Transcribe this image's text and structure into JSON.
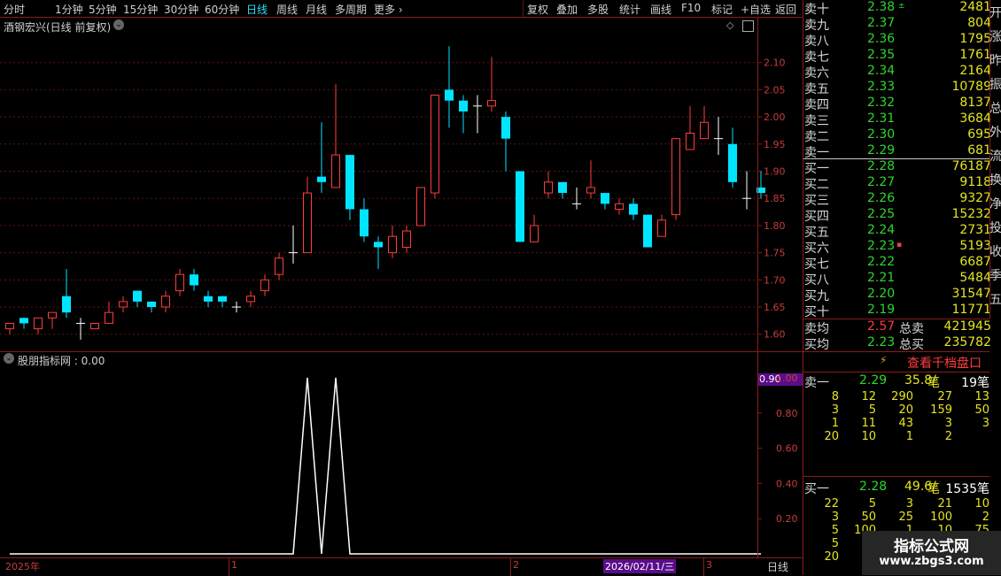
{
  "toolbar": {
    "periods": [
      "分时",
      "1分钟",
      "5分钟",
      "15分钟",
      "30分钟",
      "60分钟",
      "日线",
      "周线",
      "月线",
      "多周期",
      "更多"
    ],
    "active": "日线",
    "tools": [
      "复权",
      "叠加",
      "多股",
      "统计",
      "画线",
      "F10",
      "标记",
      "+自选",
      "返回"
    ]
  },
  "chart_title": "酒钢宏兴(日线 前复权)",
  "indicator_title": "股朋指标网 : 0.00",
  "indicator_value_tag": "0.90",
  "bottom_axis": {
    "labels": [
      "2025年",
      "1",
      "2",
      "2026/02/11/三",
      "3"
    ],
    "period": "日线"
  },
  "order_book": {
    "asks": [
      {
        "label": "卖十",
        "price": "2.38",
        "flag": "±",
        "volume": "2481"
      },
      {
        "label": "卖九",
        "price": "2.37",
        "flag": "",
        "volume": "804"
      },
      {
        "label": "卖八",
        "price": "2.36",
        "flag": "",
        "volume": "1795"
      },
      {
        "label": "卖七",
        "price": "2.35",
        "flag": "",
        "volume": "1761"
      },
      {
        "label": "卖六",
        "price": "2.34",
        "flag": "",
        "volume": "2164"
      },
      {
        "label": "卖五",
        "price": "2.33",
        "flag": "",
        "volume": "10789"
      },
      {
        "label": "卖四",
        "price": "2.32",
        "flag": "",
        "volume": "8137"
      },
      {
        "label": "卖三",
        "price": "2.31",
        "flag": "",
        "volume": "3684"
      },
      {
        "label": "卖二",
        "price": "2.30",
        "flag": "",
        "volume": "695"
      },
      {
        "label": "卖一",
        "price": "2.29",
        "flag": "",
        "volume": "681"
      }
    ],
    "bids": [
      {
        "label": "买一",
        "price": "2.28",
        "flag": "",
        "volume": "76187"
      },
      {
        "label": "买二",
        "price": "2.27",
        "flag": "",
        "volume": "9118"
      },
      {
        "label": "买三",
        "price": "2.26",
        "flag": "",
        "volume": "9327"
      },
      {
        "label": "买四",
        "price": "2.25",
        "flag": "",
        "volume": "15232"
      },
      {
        "label": "买五",
        "price": "2.24",
        "flag": "",
        "volume": "2731"
      },
      {
        "label": "买六",
        "price": "2.23",
        "flag": "▪",
        "volume": "5193"
      },
      {
        "label": "买七",
        "price": "2.22",
        "flag": "",
        "volume": "6687"
      },
      {
        "label": "买八",
        "price": "2.21",
        "flag": "",
        "volume": "5484"
      },
      {
        "label": "买九",
        "price": "2.20",
        "flag": "",
        "volume": "31547"
      },
      {
        "label": "买十",
        "price": "2.19",
        "flag": "",
        "volume": "11771"
      }
    ],
    "summary": [
      {
        "label": "卖均",
        "price": "2.57",
        "total_label": "总卖",
        "total": "421945"
      },
      {
        "label": "买均",
        "price": "2.23",
        "total_label": "总买",
        "total": "235782"
      }
    ],
    "thousand_link": "查看千档盘口",
    "sell1": {
      "label": "卖一",
      "price": "2.29",
      "avg": "35.8/",
      "unit": "笔",
      "count": "19",
      "count_unit": "笔"
    },
    "sell1_queue": [
      [
        "8",
        "12",
        "290",
        "27",
        "13"
      ],
      [
        "3",
        "5",
        "20",
        "159",
        "50"
      ],
      [
        "1",
        "11",
        "43",
        "3",
        "3"
      ],
      [
        "20",
        "10",
        "1",
        "2",
        ""
      ]
    ],
    "buy1": {
      "label": "买一",
      "price": "2.28",
      "avg": "49.6/",
      "unit": "笔",
      "count": "1535",
      "count_unit": "笔"
    },
    "buy1_queue": [
      [
        "22",
        "5",
        "3",
        "21",
        "10"
      ],
      [
        "3",
        "50",
        "25",
        "100",
        "2"
      ],
      [
        "5",
        "100",
        "1",
        "10",
        "75"
      ],
      [
        "5",
        "",
        "",
        "",
        ""
      ],
      [
        "20",
        "",
        "",
        "",
        ""
      ]
    ]
  },
  "edge_text": [
    "开",
    "涨",
    "昨",
    "振",
    "总",
    "外",
    "流",
    "换",
    "净",
    "投",
    "收",
    "季",
    "五"
  ],
  "watermark": {
    "title": "指标公式网",
    "url": "www.zbgs3.com"
  },
  "chart_data": [
    {
      "type": "candlestick",
      "title": "酒钢宏兴(日线 前复权)",
      "yticks": [
        1.6,
        1.65,
        1.7,
        1.75,
        1.8,
        1.85,
        1.9,
        1.95,
        2.0,
        2.05,
        2.1
      ],
      "ylim": [
        1.58,
        2.15
      ],
      "up_color": "#ff3c3c",
      "down_color": "#00e5ff",
      "doji_color": "#ffffff",
      "candles": [
        {
          "o": 1.61,
          "c": 1.62,
          "h": 1.62,
          "l": 1.6
        },
        {
          "o": 1.63,
          "c": 1.62,
          "h": 1.63,
          "l": 1.61
        },
        {
          "o": 1.61,
          "c": 1.63,
          "h": 1.63,
          "l": 1.6
        },
        {
          "o": 1.63,
          "c": 1.64,
          "h": 1.64,
          "l": 1.61
        },
        {
          "o": 1.67,
          "c": 1.64,
          "h": 1.72,
          "l": 1.63
        },
        {
          "o": 1.62,
          "c": 1.62,
          "h": 1.63,
          "l": 1.59
        },
        {
          "o": 1.61,
          "c": 1.62,
          "h": 1.62,
          "l": 1.61
        },
        {
          "o": 1.62,
          "c": 1.64,
          "h": 1.66,
          "l": 1.62
        },
        {
          "o": 1.65,
          "c": 1.66,
          "h": 1.67,
          "l": 1.64
        },
        {
          "o": 1.68,
          "c": 1.66,
          "h": 1.68,
          "l": 1.65
        },
        {
          "o": 1.66,
          "c": 1.65,
          "h": 1.66,
          "l": 1.64
        },
        {
          "o": 1.65,
          "c": 1.67,
          "h": 1.68,
          "l": 1.64
        },
        {
          "o": 1.68,
          "c": 1.71,
          "h": 1.72,
          "l": 1.67
        },
        {
          "o": 1.71,
          "c": 1.69,
          "h": 1.72,
          "l": 1.68
        },
        {
          "o": 1.67,
          "c": 1.66,
          "h": 1.68,
          "l": 1.65
        },
        {
          "o": 1.67,
          "c": 1.66,
          "h": 1.67,
          "l": 1.65
        },
        {
          "o": 1.65,
          "c": 1.65,
          "h": 1.66,
          "l": 1.64
        },
        {
          "o": 1.66,
          "c": 1.67,
          "h": 1.68,
          "l": 1.65
        },
        {
          "o": 1.68,
          "c": 1.7,
          "h": 1.71,
          "l": 1.67
        },
        {
          "o": 1.71,
          "c": 1.74,
          "h": 1.75,
          "l": 1.7
        },
        {
          "o": 1.75,
          "c": 1.75,
          "h": 1.8,
          "l": 1.73
        },
        {
          "o": 1.75,
          "c": 1.86,
          "h": 1.89,
          "l": 1.75
        },
        {
          "o": 1.89,
          "c": 1.88,
          "h": 1.99,
          "l": 1.86
        },
        {
          "o": 1.87,
          "c": 1.93,
          "h": 2.06,
          "l": 1.87
        },
        {
          "o": 1.93,
          "c": 1.83,
          "h": 1.93,
          "l": 1.81
        },
        {
          "o": 1.83,
          "c": 1.78,
          "h": 1.85,
          "l": 1.77
        },
        {
          "o": 1.77,
          "c": 1.76,
          "h": 1.78,
          "l": 1.72
        },
        {
          "o": 1.75,
          "c": 1.78,
          "h": 1.8,
          "l": 1.74
        },
        {
          "o": 1.76,
          "c": 1.79,
          "h": 1.8,
          "l": 1.75
        },
        {
          "o": 1.8,
          "c": 1.87,
          "h": 1.87,
          "l": 1.8
        },
        {
          "o": 1.86,
          "c": 2.04,
          "h": 2.04,
          "l": 1.85
        },
        {
          "o": 2.05,
          "c": 2.03,
          "h": 2.13,
          "l": 1.98
        },
        {
          "o": 2.03,
          "c": 2.01,
          "h": 2.04,
          "l": 1.97
        },
        {
          "o": 2.02,
          "c": 2.02,
          "h": 2.04,
          "l": 1.97
        },
        {
          "o": 2.02,
          "c": 2.03,
          "h": 2.11,
          "l": 2.01
        },
        {
          "o": 2.0,
          "c": 1.96,
          "h": 2.01,
          "l": 1.9
        },
        {
          "o": 1.9,
          "c": 1.77,
          "h": 1.9,
          "l": 1.77
        },
        {
          "o": 1.77,
          "c": 1.8,
          "h": 1.82,
          "l": 1.77
        },
        {
          "o": 1.86,
          "c": 1.88,
          "h": 1.9,
          "l": 1.85
        },
        {
          "o": 1.88,
          "c": 1.86,
          "h": 1.88,
          "l": 1.85
        },
        {
          "o": 1.84,
          "c": 1.84,
          "h": 1.87,
          "l": 1.83
        },
        {
          "o": 1.86,
          "c": 1.87,
          "h": 1.92,
          "l": 1.85
        },
        {
          "o": 1.86,
          "c": 1.84,
          "h": 1.86,
          "l": 1.83
        },
        {
          "o": 1.83,
          "c": 1.84,
          "h": 1.85,
          "l": 1.82
        },
        {
          "o": 1.84,
          "c": 1.82,
          "h": 1.85,
          "l": 1.81
        },
        {
          "o": 1.82,
          "c": 1.76,
          "h": 1.82,
          "l": 1.76
        },
        {
          "o": 1.78,
          "c": 1.81,
          "h": 1.82,
          "l": 1.78
        },
        {
          "o": 1.82,
          "c": 1.96,
          "h": 1.96,
          "l": 1.81
        },
        {
          "o": 1.94,
          "c": 1.97,
          "h": 2.02,
          "l": 1.94
        },
        {
          "o": 1.96,
          "c": 1.99,
          "h": 2.02,
          "l": 1.96
        },
        {
          "o": 1.96,
          "c": 1.96,
          "h": 2.0,
          "l": 1.93
        },
        {
          "o": 1.95,
          "c": 1.88,
          "h": 1.98,
          "l": 1.87
        },
        {
          "o": 1.85,
          "c": 1.85,
          "h": 1.9,
          "l": 1.83
        },
        {
          "o": 1.87,
          "c": 1.86,
          "h": 1.9,
          "l": 1.85
        }
      ]
    },
    {
      "type": "line",
      "title": "股朋指标网",
      "yticks": [
        0.2,
        0.4,
        0.6,
        0.8,
        1.0
      ],
      "ylim": [
        0,
        1.05
      ],
      "color": "#ffffff",
      "values": [
        0,
        0,
        0,
        0,
        0,
        0,
        0,
        0,
        0,
        0,
        0,
        0,
        0,
        0,
        0,
        0,
        0,
        0,
        0,
        0,
        0,
        1,
        0,
        1,
        0,
        0,
        0,
        0,
        0,
        0,
        0,
        0,
        0,
        0,
        0,
        0,
        0,
        0,
        0,
        0,
        0,
        0,
        0,
        0,
        0,
        0,
        0,
        0,
        0,
        0,
        0,
        0,
        0,
        0
      ]
    }
  ]
}
